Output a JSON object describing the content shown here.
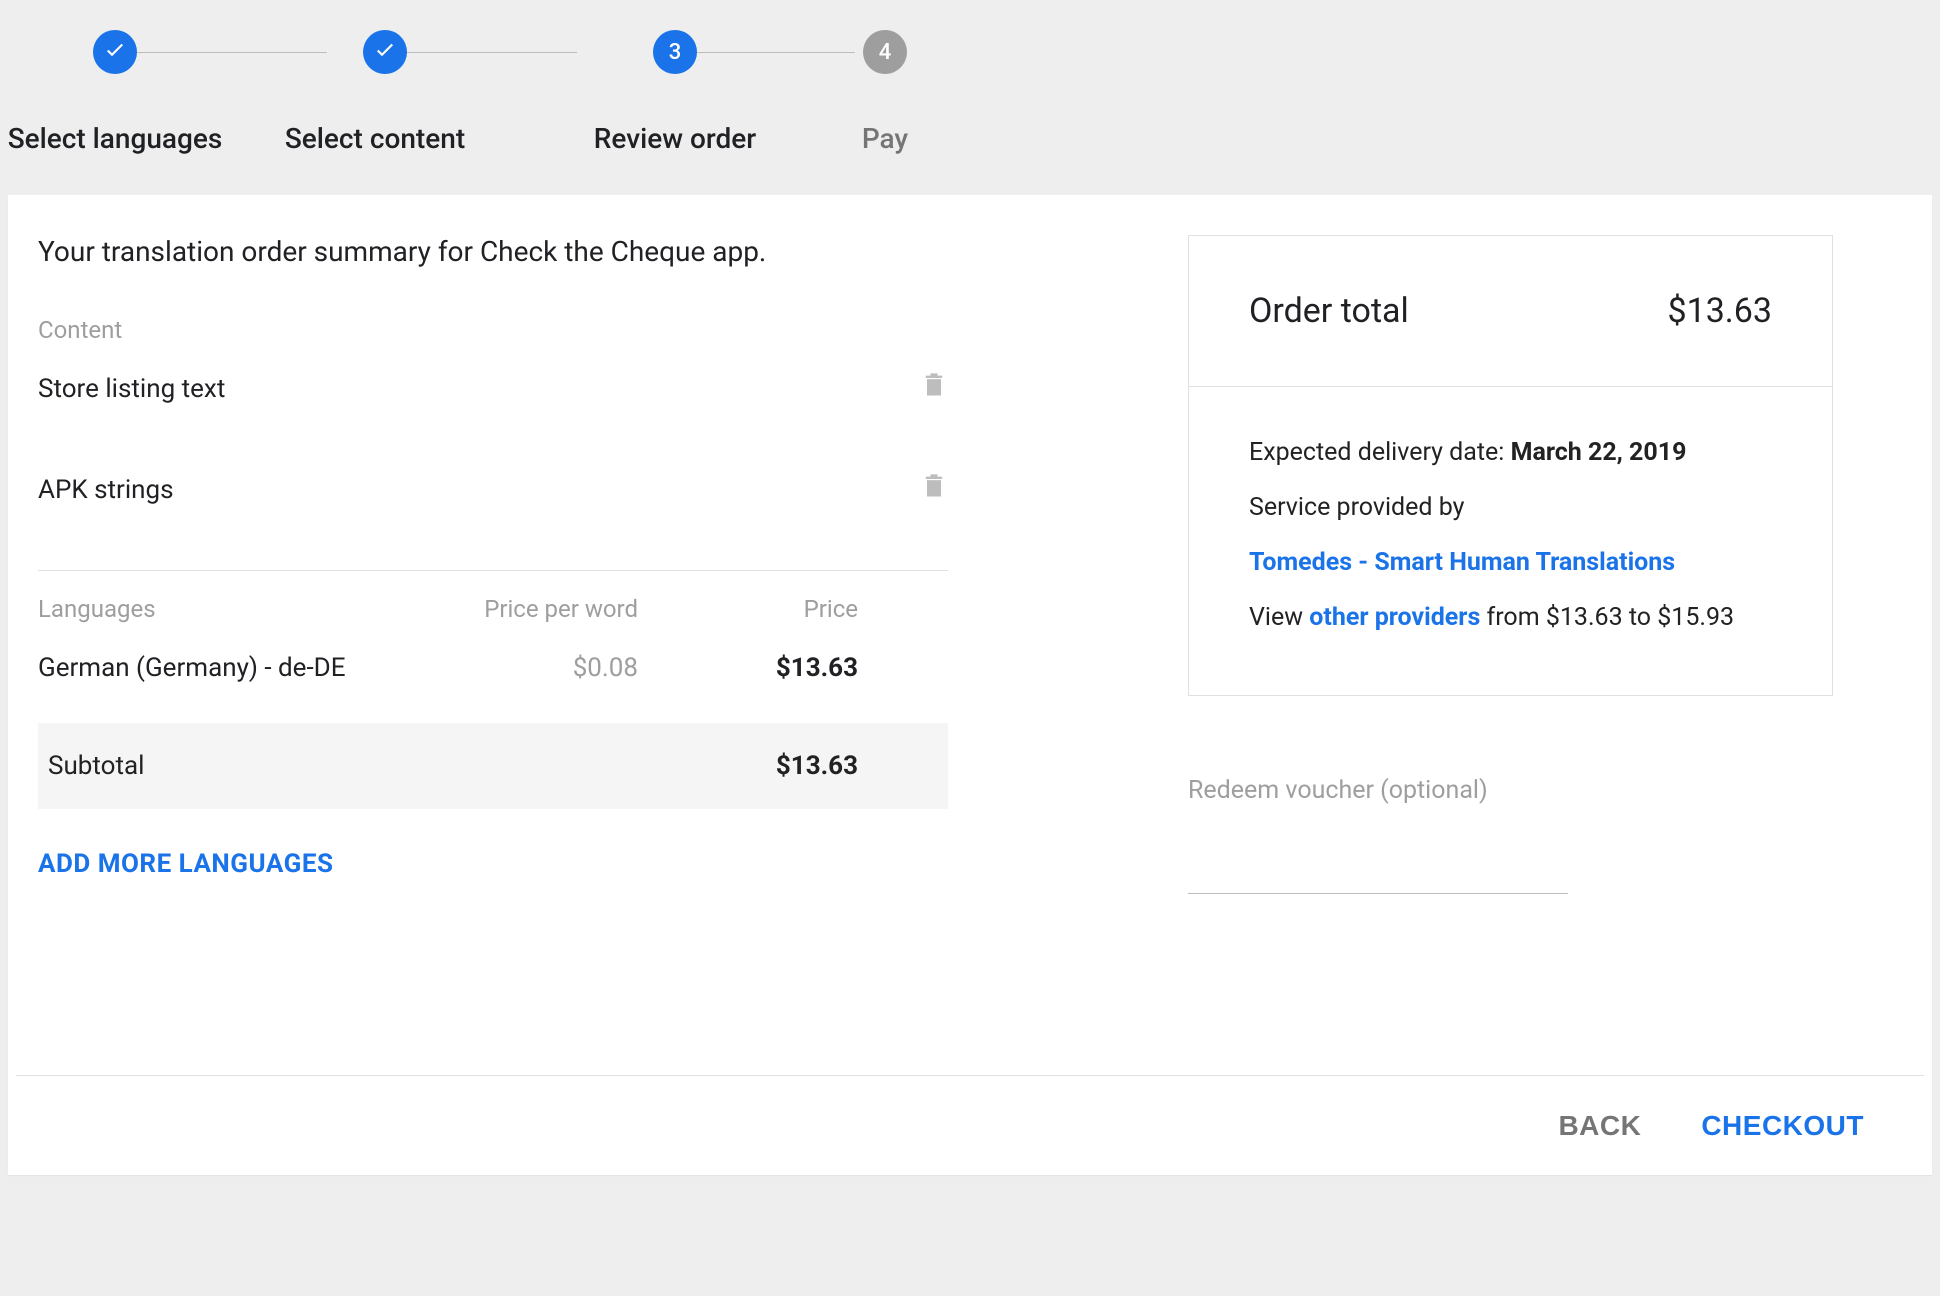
{
  "stepper": {
    "steps": [
      {
        "label": "Select languages",
        "state": "done"
      },
      {
        "label": "Select content",
        "state": "done"
      },
      {
        "label": "Review order",
        "state": "active",
        "badge": "3"
      },
      {
        "label": "Pay",
        "state": "inactive",
        "badge": "4"
      }
    ]
  },
  "summary": {
    "heading": "Your translation order summary for Check the Cheque app.",
    "content_heading": "Content",
    "content_items": [
      {
        "label": "Store listing text"
      },
      {
        "label": "APK strings"
      }
    ],
    "languages_heading": "Languages",
    "price_per_word_heading": "Price per word",
    "price_heading": "Price",
    "languages": [
      {
        "name": "German (Germany) - de-DE",
        "price_per_word": "$0.08",
        "price": "$13.63"
      }
    ],
    "subtotal_label": "Subtotal",
    "subtotal_value": "$13.63",
    "add_more_label": "Add more languages"
  },
  "order": {
    "total_label": "Order total",
    "total_value": "$13.63",
    "expected_label": "Expected delivery date: ",
    "expected_date": "March 22, 2019",
    "service_label": "Service provided by",
    "provider_name": "Tomedes - Smart Human Translations",
    "view_prefix": "View ",
    "other_providers_link": "other providers",
    "price_range_suffix": " from $13.63 to $15.93",
    "voucher_label": "Redeem voucher (optional)"
  },
  "footer": {
    "back": "Back",
    "checkout": "Checkout"
  }
}
